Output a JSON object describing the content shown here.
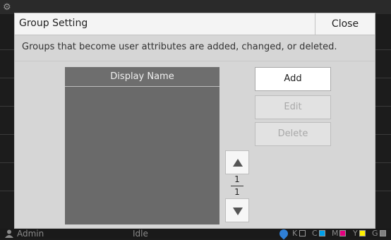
{
  "dialog": {
    "title": "Group Setting",
    "close_label": "Close",
    "description": "Groups that become user attributes are added, changed, or deleted."
  },
  "list": {
    "header": "Display Name",
    "items": []
  },
  "actions": {
    "add": "Add",
    "edit": "Edit",
    "delete": "Delete"
  },
  "pager": {
    "current": "1",
    "total": "1"
  },
  "status": {
    "user": "Admin",
    "state": "Idle",
    "inks": [
      {
        "label": "K",
        "color": "#000000"
      },
      {
        "label": "C",
        "color": "#00a0e9"
      },
      {
        "label": "M",
        "color": "#e4007f"
      },
      {
        "label": "Y",
        "color": "#fff100"
      },
      {
        "label": "G",
        "color": "#808080"
      }
    ]
  },
  "colors": {
    "dialog_bg": "#d6d6d6",
    "list_bg": "#6a6a6a",
    "accent_ink_blue": "#2f7fd6"
  }
}
